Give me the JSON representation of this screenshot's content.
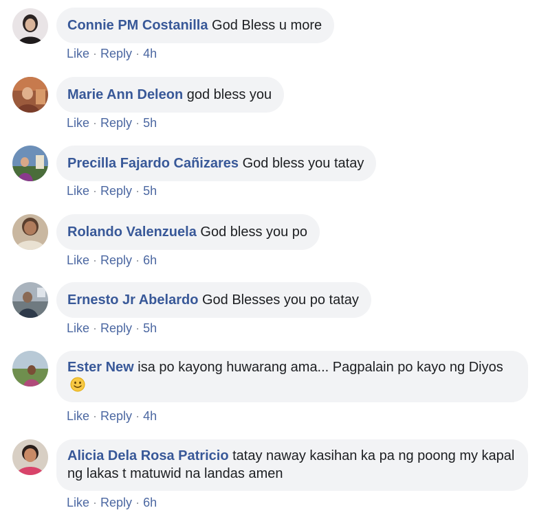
{
  "comments": [
    {
      "author": "Connie PM Costanilla",
      "text": "God Bless u more",
      "like": "Like",
      "reply": "Reply",
      "sep": "·",
      "time": "4h",
      "avatar_icon": "profile-photo"
    },
    {
      "author": "Marie Ann Deleon",
      "text": "god bless you",
      "like": "Like",
      "reply": "Reply",
      "sep": "·",
      "time": "5h",
      "avatar_icon": "profile-photo"
    },
    {
      "author": "Precilla Fajardo Cañizares",
      "text": "God bless you tatay",
      "like": "Like",
      "reply": "Reply",
      "sep": "·",
      "time": "5h",
      "avatar_icon": "profile-photo"
    },
    {
      "author": "Rolando Valenzuela",
      "text": "God bless you po",
      "like": "Like",
      "reply": "Reply",
      "sep": "·",
      "time": "6h",
      "avatar_icon": "profile-photo"
    },
    {
      "author": "Ernesto Jr Abelardo",
      "text": "God Blesses you po tatay",
      "like": "Like",
      "reply": "Reply",
      "sep": "·",
      "time": "5h",
      "avatar_icon": "profile-photo"
    },
    {
      "author": "Ester New",
      "text": "isa po kayong huwarang ama... Pagpalain po kayo ng Diyos",
      "like": "Like",
      "reply": "Reply",
      "sep": "·",
      "time": "4h",
      "avatar_icon": "profile-photo",
      "emoji": "slightly-smiling-face-icon"
    },
    {
      "author": "Alicia Dela Rosa Patricio",
      "text": "tatay naway kasihan ka pa ng poong my kapal ng lakas t matuwid na landas amen",
      "like": "Like",
      "reply": "Reply",
      "sep": "·",
      "time": "6h",
      "avatar_icon": "profile-photo"
    }
  ],
  "colors": {
    "author_link": "#385898",
    "action_link": "#4b67a1",
    "bubble_bg": "#f2f3f5",
    "body_text": "#1c1e21"
  }
}
